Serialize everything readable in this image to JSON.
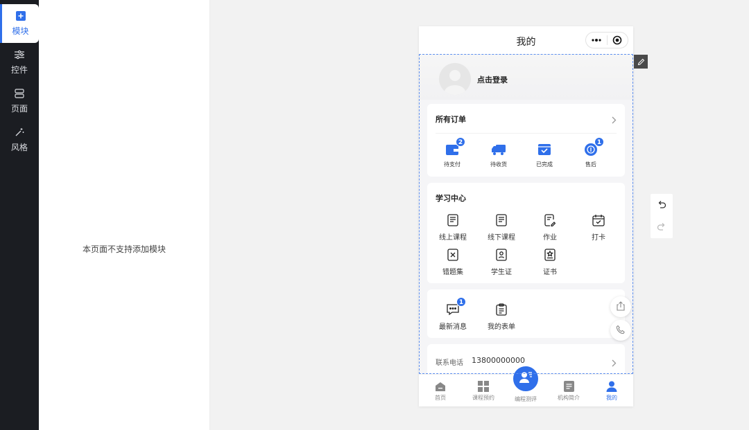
{
  "sidebar": {
    "items": [
      {
        "label": "模块",
        "icon": "plus-square-icon",
        "active": true
      },
      {
        "label": "控件",
        "icon": "sliders-icon"
      },
      {
        "label": "页面",
        "icon": "page-icon"
      },
      {
        "label": "风格",
        "icon": "magic-wand-icon"
      }
    ]
  },
  "panel": {
    "empty_text": "本页面不支持添加模块"
  },
  "phone": {
    "title": "我的",
    "profile": {
      "login_text": "点击登录"
    },
    "orders": {
      "title": "所有订单",
      "items": [
        {
          "label": "待支付",
          "badge": "2",
          "icon": "wallet-icon"
        },
        {
          "label": "待收货",
          "icon": "truck-icon"
        },
        {
          "label": "已完成",
          "icon": "box-check-icon"
        },
        {
          "label": "售后",
          "badge": "1",
          "icon": "coin-icon"
        }
      ]
    },
    "study": {
      "title": "学习中心",
      "items": [
        {
          "label": "线上课程",
          "icon": "online-course-icon"
        },
        {
          "label": "线下课程",
          "icon": "offline-course-icon"
        },
        {
          "label": "作业",
          "icon": "homework-icon"
        },
        {
          "label": "打卡",
          "icon": "calendar-check-icon"
        },
        {
          "label": "错题集",
          "icon": "wrong-questions-icon"
        },
        {
          "label": "学生证",
          "icon": "student-id-icon"
        },
        {
          "label": "证书",
          "icon": "certificate-icon"
        }
      ]
    },
    "misc": {
      "items": [
        {
          "label": "最新消息",
          "badge": "1",
          "icon": "message-icon"
        },
        {
          "label": "我的表单",
          "icon": "clipboard-icon"
        }
      ]
    },
    "contact": {
      "label": "联系电话",
      "value": "13800000000"
    },
    "tabbar": {
      "items": [
        {
          "label": "首页",
          "icon": "home-icon"
        },
        {
          "label": "课程预约",
          "icon": "grid-icon"
        },
        {
          "label": "编程测评",
          "icon": "assessment-icon"
        },
        {
          "label": "机构简介",
          "icon": "document-icon"
        },
        {
          "label": "我的",
          "icon": "user-icon",
          "active": true
        }
      ]
    }
  },
  "colors": {
    "accent": "#2f6fea",
    "rail": "#1b1d22"
  }
}
